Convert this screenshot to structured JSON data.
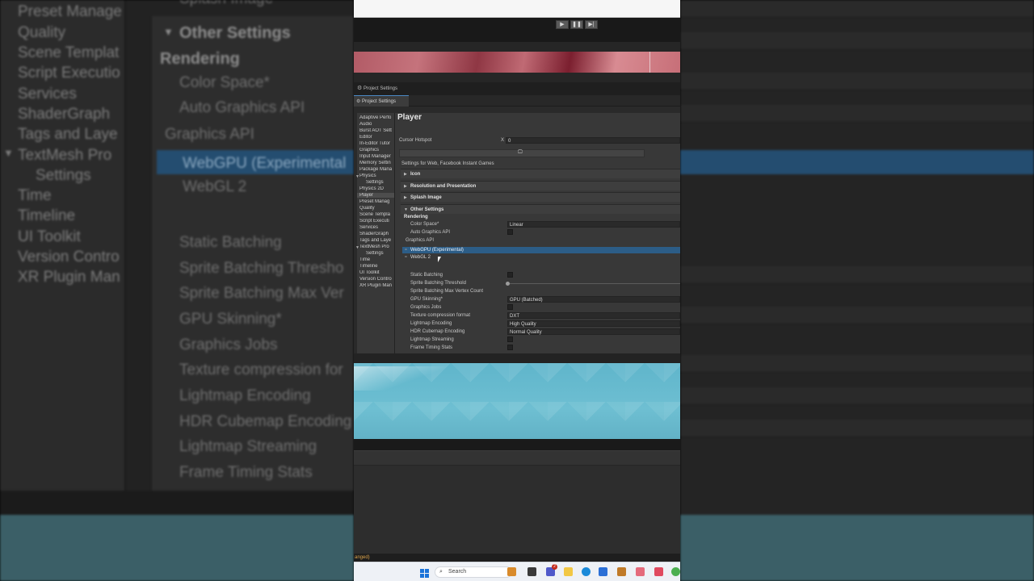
{
  "window": {
    "title": "Project Settings",
    "tab_label": "Project Settings"
  },
  "sidebar": {
    "items": [
      "Adaptive Perfo",
      "Audio",
      "Burst AOT Sett",
      "Editor",
      "In-Editor Tutor",
      "Graphics",
      "Input Manager",
      "Memory Settin",
      "Package Mana",
      "Physics",
      "Settings",
      "Physics 2D",
      "Player",
      "Preset Manag",
      "Quality",
      "Scene Templa",
      "Script Executi",
      "Services",
      "ShaderGraph",
      "Tags and Laye",
      "TextMesh Pro",
      "Settings",
      "Time",
      "Timeline",
      "UI Toolkit",
      "Version Contro",
      "XR Plugin Man"
    ]
  },
  "player": {
    "title": "Player",
    "cursor_hotspot_label": "Cursor Hotspot",
    "cursor_x_label": "X",
    "cursor_x_value": "0",
    "settings_for": "Settings for Web, Facebook Instant Games",
    "sections": {
      "icon": "Icon",
      "resolution": "Resolution and Presentation",
      "splash": "Splash Image",
      "other": "Other Settings"
    },
    "rendering_header": "Rendering",
    "color_space_label": "Color Space*",
    "color_space_value": "Linear",
    "auto_graphics_label": "Auto Graphics API",
    "graphics_api_label": "Graphics API",
    "graphics_apis": [
      "WebGPU (Experimental)",
      "WebGL 2"
    ],
    "static_batching_label": "Static Batching",
    "sprite_threshold_label": "Sprite Batching Threshold",
    "sprite_max_label": "Sprite Batching Max Vertex Count",
    "gpu_skinning_label": "GPU Skinning*",
    "gpu_skinning_value": "GPU (Batched)",
    "graphics_jobs_label": "Graphics Jobs",
    "texture_compression_label": "Texture compression format",
    "texture_compression_value": "DXT",
    "lightmap_encoding_label": "Lightmap Encoding",
    "lightmap_encoding_value": "High Quality",
    "hdr_cubemap_label": "HDR Cubemap Encoding",
    "hdr_cubemap_value": "Normal Quality",
    "lightmap_streaming_label": "Lightmap Streaming",
    "frame_timing_label": "Frame Timing Stats"
  },
  "background_zoom": {
    "sidebar_items": [
      "Preset Manage",
      "Quality",
      "Scene Templat",
      "Script Executio",
      "Services",
      "ShaderGraph",
      "Tags and Laye",
      "TextMesh Pro",
      "Settings",
      "Time",
      "Timeline",
      "UI Toolkit",
      "Version Contro",
      "XR Plugin Man"
    ],
    "splash_header": "Splash Image",
    "other_settings": "Other Settings",
    "rendering": "Rendering",
    "color_space": "Color Space*",
    "auto_graphics": "Auto Graphics API",
    "graphics_api": "Graphics API",
    "webgpu": "WebGPU (Experimental",
    "webgl": "WebGL 2",
    "rows": [
      "Static Batching",
      "Sprite Batching Thresho",
      "Sprite Batching Max Ver",
      "GPU Skinning*",
      "Graphics Jobs",
      "Texture compression for",
      "Lightmap Encoding",
      "HDR Cubemap Encoding",
      "Lightmap Streaming",
      "Frame Timing Stats"
    ]
  },
  "status": {
    "text": "anged)"
  },
  "taskbar": {
    "search_placeholder": "Search",
    "badge": "2"
  },
  "colors": {
    "accent": "#2c5d87",
    "scene": "#6ebfd2",
    "background": "#383838"
  }
}
